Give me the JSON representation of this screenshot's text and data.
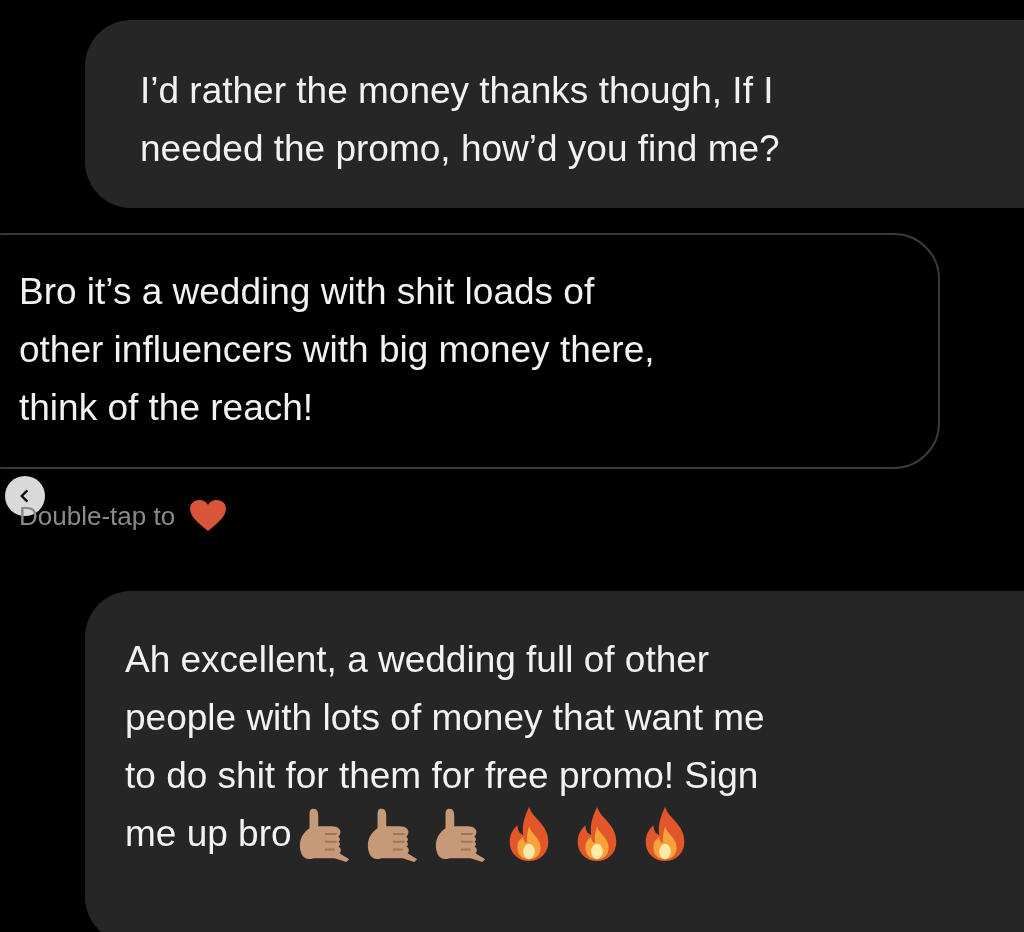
{
  "messages": [
    {
      "kind": "sent",
      "lines": [
        "I’d rather the money thanks though, If I",
        "needed the promo, how’d you find me?"
      ]
    },
    {
      "kind": "received",
      "lines": [
        "Bro it’s a wedding with shit loads of",
        "other influencers with big money there,",
        "think of the reach!"
      ],
      "hint": "Double-tap to"
    },
    {
      "kind": "sent",
      "lines": [
        "Ah excellent, a wedding full of other",
        "people with lots of money that want me",
        "to do shit for them for free promo! Sign",
        "me up bro"
      ],
      "emoji": [
        {
          "kind": "shaka"
        },
        {
          "kind": "shaka"
        },
        {
          "kind": "shaka"
        },
        {
          "kind": "fire"
        },
        {
          "kind": "fire"
        },
        {
          "kind": "fire"
        }
      ]
    }
  ]
}
